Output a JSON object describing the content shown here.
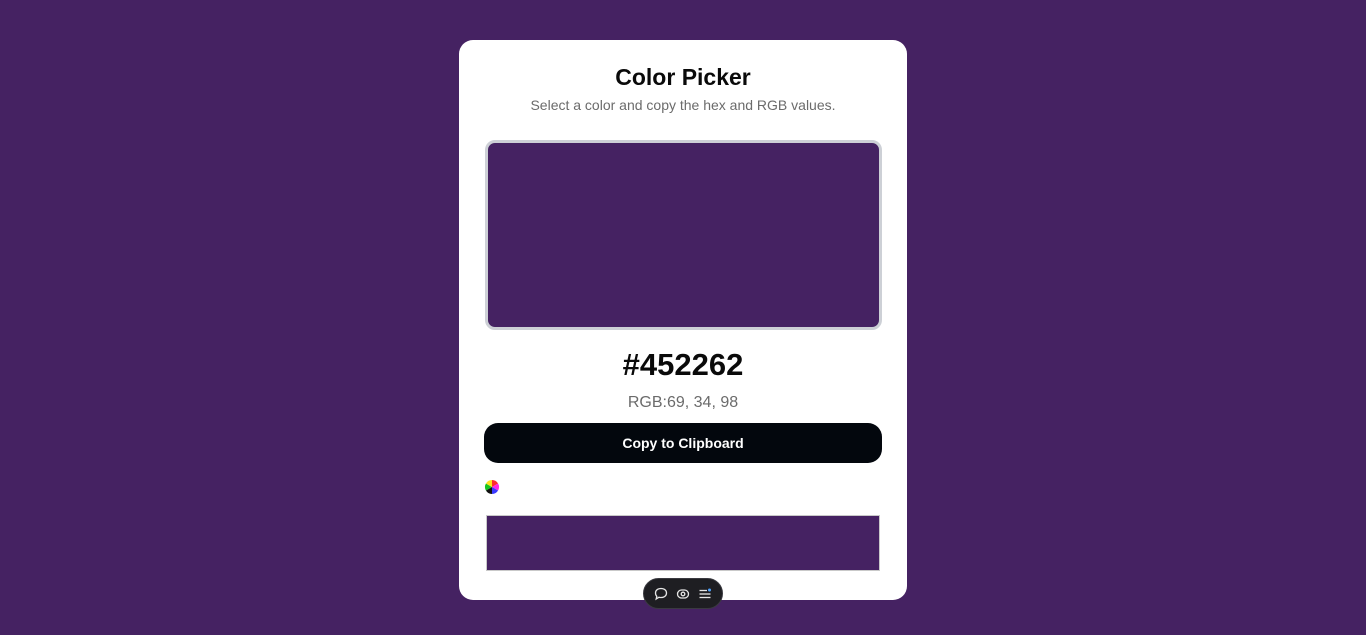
{
  "app": {
    "title": "Color Picker",
    "subtitle": "Select a color and copy the hex and RGB values."
  },
  "color": {
    "hex": "#452262",
    "rgb_label": "RGB:",
    "rgb_values": "69, 34, 98",
    "rgb_text": "RGB:69, 34, 98"
  },
  "actions": {
    "copy_label": "Copy to Clipboard"
  },
  "icons": {
    "picker": "color-wheel-icon",
    "toolbar": [
      "comment-icon",
      "eye-icon",
      "menu-list-icon"
    ]
  },
  "theme": {
    "background": "#452262",
    "card": "#ffffff",
    "button": "#03070d",
    "preview_border": "#cdd0d6",
    "toolbar": "#1e1e22"
  }
}
